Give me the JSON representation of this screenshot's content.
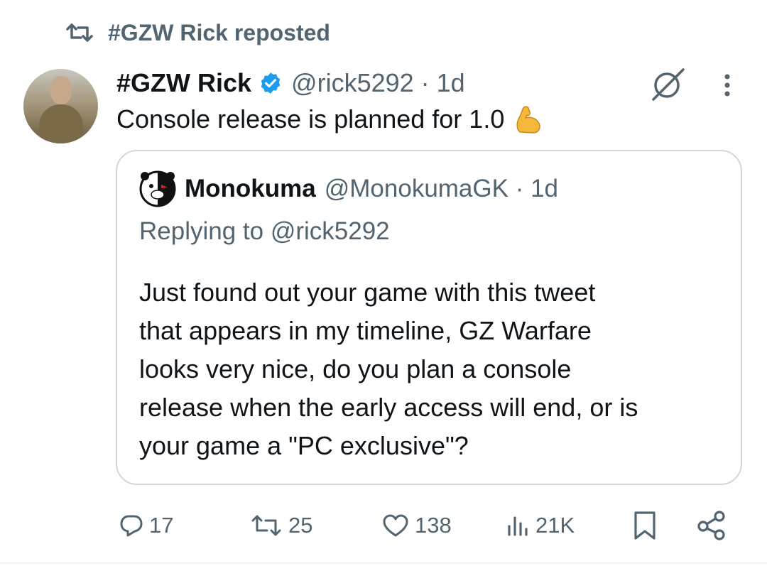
{
  "repost": {
    "label": "#GZW Rick reposted",
    "icon": "repost-icon"
  },
  "tweet": {
    "author_name": "#GZW Rick",
    "verified": true,
    "handle_time": "@rick5292 · 1d",
    "text": "Console release is planned for 1.0",
    "emoji": "flexed-biceps"
  },
  "quote": {
    "author_name": "Monokuma",
    "handle_time": "@MonokumaGK · 1d",
    "reply_to": "Replying to @rick5292",
    "text": "Just found out your game with this tweet\nthat appears in my timeline, GZ Warfare\nlooks very nice, do you plan a console\nrelease when the early access will end, or is\nyour game a \"PC exclusive\"?"
  },
  "actions": {
    "replies": "17",
    "reposts": "25",
    "likes": "138",
    "views": "21K"
  },
  "colors": {
    "verified": "#1d9bf0",
    "muted": "#536471",
    "text": "#0f1419",
    "border": "#cfd9de"
  }
}
